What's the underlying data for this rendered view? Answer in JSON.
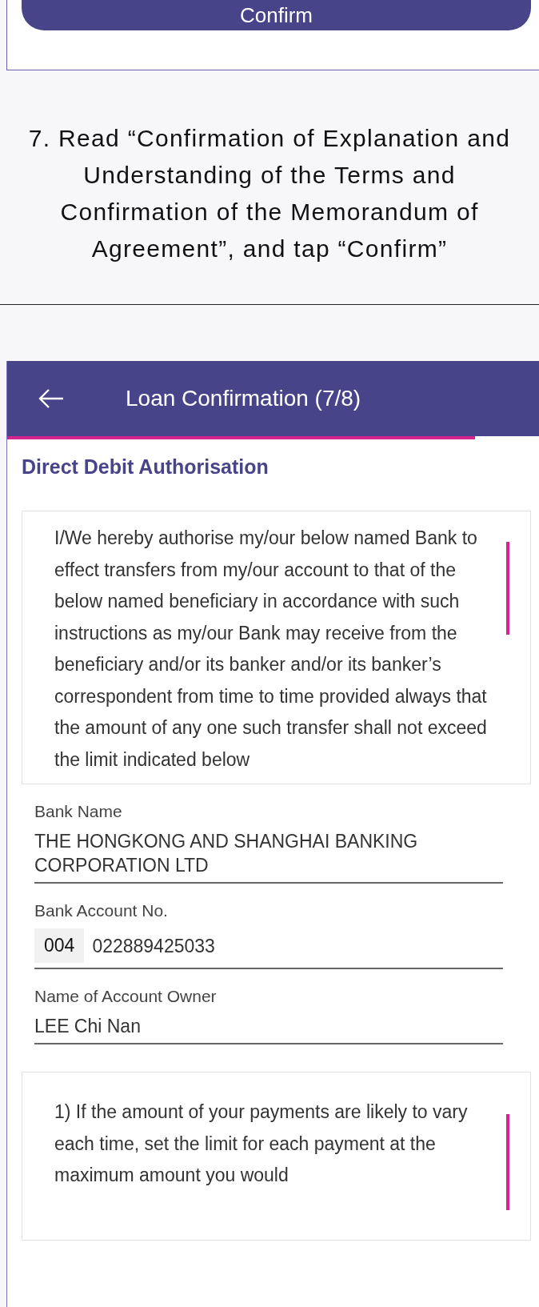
{
  "top_card": {
    "button": "Confirm"
  },
  "instruction": "7. Read “Confirmation of Explanation and Understanding of the Terms and Confirmation of the Memorandum of Agreement”, and tap “Confirm”",
  "phone": {
    "header": {
      "title": "Loan Confirmation (7/8)"
    },
    "progress": {
      "level": 0.88
    },
    "section_title": "Direct Debit Authorisation",
    "terms_text": "I/We hereby authorise my/our below named Bank to effect transfers from my/our account to that of the below named beneficiary in accordance with such instructions as my/our Bank may receive from the beneficiary and/or its banker and/or its banker’s correspondent from time to time provided always that the amount of any one such transfer shall not exceed the limit indicated below",
    "fields": [
      {
        "label": "Bank Name",
        "value": "THE HONGKONG AND SHANGHAI BANKING CORPORATION LTD"
      },
      {
        "label": "Bank Account No.",
        "prefix": "004",
        "value": "022889425033"
      },
      {
        "label": "Name of Account Owner",
        "value": "LEE Chi Nan"
      }
    ],
    "note_text": "1)  If the amount of your payments are likely to vary each time, set the limit for each payment at the maximum amount you would"
  }
}
